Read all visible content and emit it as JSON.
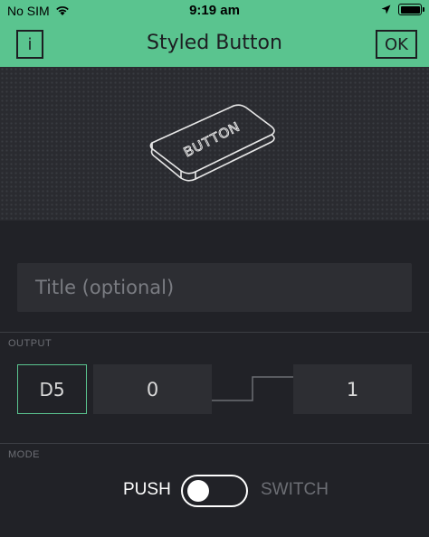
{
  "status_bar": {
    "carrier": "No SIM",
    "time": "9:19 am",
    "icons": [
      "wifi-icon",
      "location-arrow-icon",
      "battery-icon"
    ]
  },
  "nav": {
    "info_label": "i",
    "title": "Styled Button",
    "ok_label": "OK"
  },
  "preview": {
    "button_text": "BUTTON"
  },
  "title_field": {
    "placeholder": "Title (optional)",
    "value": ""
  },
  "output": {
    "section_label": "OUTPUT",
    "pin": "D5",
    "low_value": "0",
    "high_value": "1"
  },
  "mode": {
    "section_label": "MODE",
    "left_label": "PUSH",
    "right_label": "SWITCH",
    "selected": "PUSH"
  },
  "colors": {
    "accent": "#5ac48f",
    "background": "#212227",
    "field": "#2d2e33"
  }
}
